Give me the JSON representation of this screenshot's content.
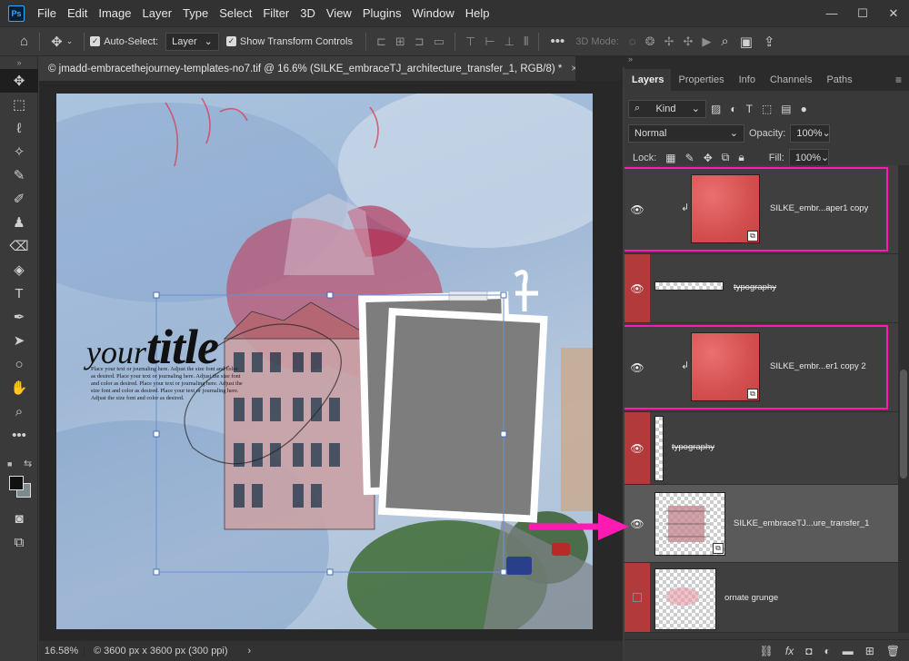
{
  "app": {
    "logo": "Ps"
  },
  "menu": [
    "File",
    "Edit",
    "Image",
    "Layer",
    "Type",
    "Select",
    "Filter",
    "3D",
    "View",
    "Plugins",
    "Window",
    "Help"
  ],
  "window_controls": {
    "minimize": "—",
    "restore": "☐",
    "close": "✕"
  },
  "options": {
    "auto_select_label": "Auto-Select:",
    "auto_select_target": "Layer",
    "show_transform_label": "Show Transform Controls",
    "mode_3d_label": "3D Mode:"
  },
  "document": {
    "tab_title": "© jmadd-embracethejourney-templates-no7.tif @ 16.6% (SILKE_embraceTJ_architecture_transfer_1, RGB/8) *",
    "tab_close": "×",
    "zoom": "16.58%",
    "doc_info": "© 3600 px x 3600 px (300 ppi)",
    "status_arrow": "›"
  },
  "canvas": {
    "title_your": "your",
    "title_title": "title",
    "journal_text": "Place your text or journaling here. Adjust the size font and color as desired. Place your text or journaling here. Adjust the size font and color as desired. Place your text or journaling here. Adjust the size font and color as desired. Place your text or journaling here. Adjust the size font and color as desired."
  },
  "panel": {
    "tabs": [
      "Layers",
      "Properties",
      "Info",
      "Channels",
      "Paths"
    ],
    "menu_icon": "≡",
    "filter_kind": "Kind",
    "blend_mode": "Normal",
    "opacity_label": "Opacity:",
    "opacity_value": "100%",
    "lock_label": "Lock:",
    "fill_label": "Fill:",
    "fill_value": "100%"
  },
  "layers": [
    {
      "name": "SILKE_embr...aper1 copy",
      "visible": true,
      "highlighted": true
    },
    {
      "name": "typography",
      "visible": true,
      "highlighted": false
    },
    {
      "name": "SILKE_embr...er1 copy 2",
      "visible": true,
      "highlighted": true
    },
    {
      "name": "typography",
      "visible": true,
      "highlighted": false
    },
    {
      "name": "SILKE_embraceTJ...ure_transfer_1",
      "visible": true,
      "selected": true
    },
    {
      "name": "ornate grunge",
      "visible": false,
      "highlighted": false
    }
  ],
  "colors": {
    "highlight": "#ff1ab3",
    "arrow": "#ff1ab3",
    "layer_red": "#b23a3a",
    "canvas_blue": "#a7bfd8",
    "frame_gray": "#7d7d7d"
  }
}
